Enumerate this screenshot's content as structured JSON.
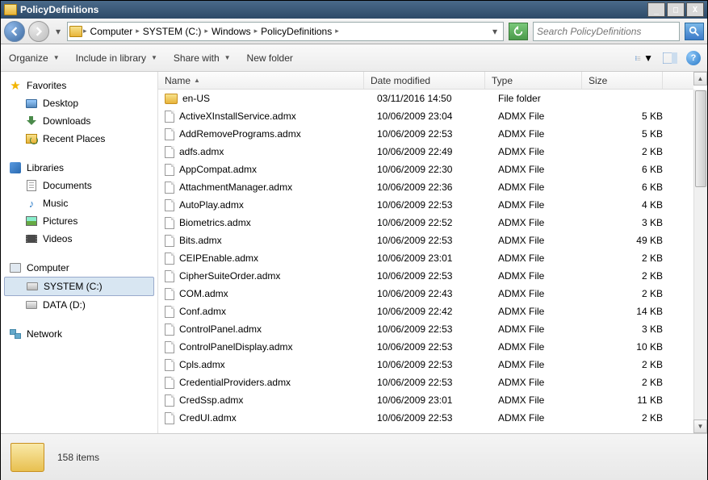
{
  "window": {
    "title": "PolicyDefinitions"
  },
  "breadcrumb": [
    "Computer",
    "SYSTEM (C:)",
    "Windows",
    "PolicyDefinitions"
  ],
  "search": {
    "placeholder": "Search PolicyDefinitions"
  },
  "toolbar": {
    "organize": "Organize",
    "include": "Include in library",
    "share": "Share with",
    "newfolder": "New folder"
  },
  "columns": {
    "name": "Name",
    "date": "Date modified",
    "type": "Type",
    "size": "Size"
  },
  "nav": {
    "favorites": "Favorites",
    "desktop": "Desktop",
    "downloads": "Downloads",
    "recent": "Recent Places",
    "libraries": "Libraries",
    "documents": "Documents",
    "music": "Music",
    "pictures": "Pictures",
    "videos": "Videos",
    "computer": "Computer",
    "sysc": "SYSTEM (C:)",
    "datad": "DATA (D:)",
    "network": "Network"
  },
  "files": [
    {
      "name": "en-US",
      "date": "03/11/2016 14:50",
      "type": "File folder",
      "size": "",
      "icon": "folder"
    },
    {
      "name": "ActiveXInstallService.admx",
      "date": "10/06/2009 23:04",
      "type": "ADMX File",
      "size": "5 KB",
      "icon": "admx"
    },
    {
      "name": "AddRemovePrograms.admx",
      "date": "10/06/2009 22:53",
      "type": "ADMX File",
      "size": "5 KB",
      "icon": "admx"
    },
    {
      "name": "adfs.admx",
      "date": "10/06/2009 22:49",
      "type": "ADMX File",
      "size": "2 KB",
      "icon": "admx"
    },
    {
      "name": "AppCompat.admx",
      "date": "10/06/2009 22:30",
      "type": "ADMX File",
      "size": "6 KB",
      "icon": "admx"
    },
    {
      "name": "AttachmentManager.admx",
      "date": "10/06/2009 22:36",
      "type": "ADMX File",
      "size": "6 KB",
      "icon": "admx"
    },
    {
      "name": "AutoPlay.admx",
      "date": "10/06/2009 22:53",
      "type": "ADMX File",
      "size": "4 KB",
      "icon": "admx"
    },
    {
      "name": "Biometrics.admx",
      "date": "10/06/2009 22:52",
      "type": "ADMX File",
      "size": "3 KB",
      "icon": "admx"
    },
    {
      "name": "Bits.admx",
      "date": "10/06/2009 22:53",
      "type": "ADMX File",
      "size": "49 KB",
      "icon": "admx"
    },
    {
      "name": "CEIPEnable.admx",
      "date": "10/06/2009 23:01",
      "type": "ADMX File",
      "size": "2 KB",
      "icon": "admx"
    },
    {
      "name": "CipherSuiteOrder.admx",
      "date": "10/06/2009 22:53",
      "type": "ADMX File",
      "size": "2 KB",
      "icon": "admx"
    },
    {
      "name": "COM.admx",
      "date": "10/06/2009 22:43",
      "type": "ADMX File",
      "size": "2 KB",
      "icon": "admx"
    },
    {
      "name": "Conf.admx",
      "date": "10/06/2009 22:42",
      "type": "ADMX File",
      "size": "14 KB",
      "icon": "admx"
    },
    {
      "name": "ControlPanel.admx",
      "date": "10/06/2009 22:53",
      "type": "ADMX File",
      "size": "3 KB",
      "icon": "admx"
    },
    {
      "name": "ControlPanelDisplay.admx",
      "date": "10/06/2009 22:53",
      "type": "ADMX File",
      "size": "10 KB",
      "icon": "admx"
    },
    {
      "name": "Cpls.admx",
      "date": "10/06/2009 22:53",
      "type": "ADMX File",
      "size": "2 KB",
      "icon": "admx"
    },
    {
      "name": "CredentialProviders.admx",
      "date": "10/06/2009 22:53",
      "type": "ADMX File",
      "size": "2 KB",
      "icon": "admx"
    },
    {
      "name": "CredSsp.admx",
      "date": "10/06/2009 23:01",
      "type": "ADMX File",
      "size": "11 KB",
      "icon": "admx"
    },
    {
      "name": "CredUI.admx",
      "date": "10/06/2009 22:53",
      "type": "ADMX File",
      "size": "2 KB",
      "icon": "admx"
    }
  ],
  "status": {
    "count": "158 items"
  }
}
